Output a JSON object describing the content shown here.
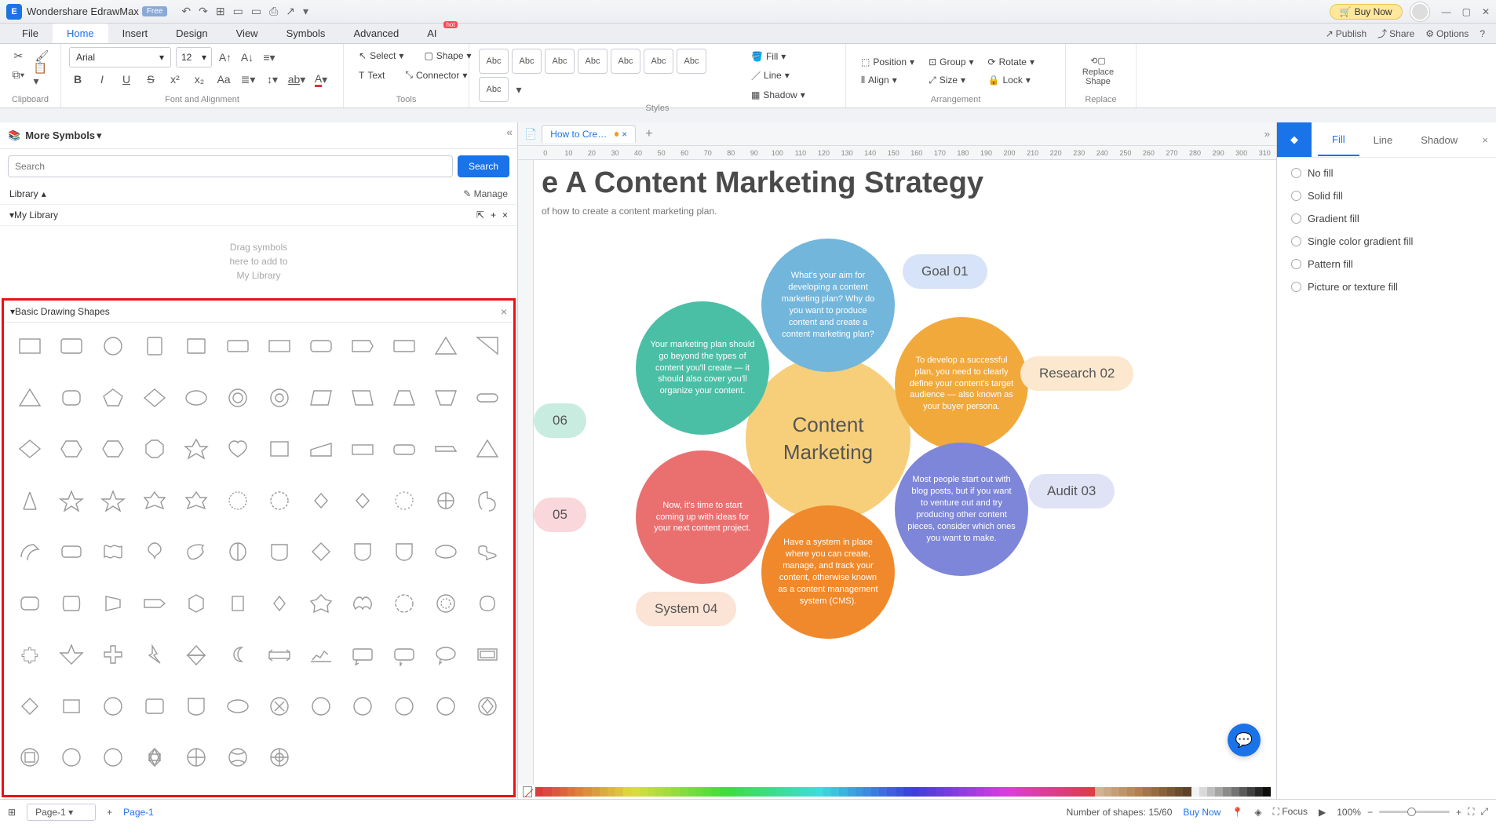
{
  "app": {
    "name": "Wondershare EdrawMax",
    "badge": "Free",
    "buy": "Buy Now"
  },
  "menu": {
    "items": [
      "File",
      "Home",
      "Insert",
      "Design",
      "View",
      "Symbols",
      "Advanced",
      "AI"
    ],
    "active": "Home",
    "right": {
      "publish": "Publish",
      "share": "Share",
      "options": "Options"
    }
  },
  "ribbon": {
    "clipboard": "Clipboard",
    "font_align": "Font and Alignment",
    "tools": "Tools",
    "styles": "Styles",
    "arrangement": "Arrangement",
    "replace": "Replace",
    "font": "Arial",
    "size": "12",
    "select": "Select",
    "shape": "Shape",
    "text": "Text",
    "connector": "Connector",
    "abc": "Abc",
    "fill": "Fill",
    "line": "Line",
    "shadow": "Shadow",
    "position": "Position",
    "align": "Align",
    "group": "Group",
    "size_btn": "Size",
    "rotate": "Rotate",
    "lock": "Lock",
    "replace_shape": "Replace\nShape"
  },
  "left": {
    "more_symbols": "More Symbols",
    "search_ph": "Search",
    "search_btn": "Search",
    "library": "Library",
    "manage": "Manage",
    "mylib": "My Library",
    "mylib_hint": "Drag symbols\nhere to add to\nMy Library",
    "basic": "Basic Drawing Shapes"
  },
  "doc": {
    "tab": "How to Create...",
    "title": "e A Content Marketing Strategy",
    "subtitle": "of how to create a content marketing plan.",
    "center": "Content\nMarketing",
    "top": "What's your aim for developing a content marketing plan? Why do you want to produce content and create a content marketing plan?",
    "teal": "Your marketing plan should go beyond the types of content you'll create — it should also cover you'll organize your content.",
    "orange_r": "To develop a successful plan, you need to clearly define your content's target audience — also known as your buyer persona.",
    "purple": "Most people start out with blog posts, but if you want to venture out and try producing other content pieces, consider which ones you want to make.",
    "red": "Now, it's time to start coming up with ideas for your next content project.",
    "orange_b": "Have a system in place where you can create, manage, and track your content, otherwise known as a content management system (CMS).",
    "goal": "Goal 01",
    "research": "Research 02",
    "audit": "Audit 03",
    "system": "System 04",
    "p05": "05",
    "p06": "06"
  },
  "right": {
    "fill": "Fill",
    "line": "Line",
    "shadow": "Shadow",
    "opts": [
      "No fill",
      "Solid fill",
      "Gradient fill",
      "Single color gradient fill",
      "Pattern fill",
      "Picture or texture fill"
    ]
  },
  "status": {
    "page": "Page-1",
    "page_link": "Page-1",
    "shapes": "Number of shapes: 15/60",
    "buy": "Buy Now",
    "focus": "Focus",
    "zoom": "100%"
  },
  "ruler": [
    "0",
    "10",
    "20",
    "30",
    "40",
    "50",
    "60",
    "70",
    "80",
    "90",
    "100",
    "110",
    "120",
    "130",
    "140",
    "150",
    "160",
    "170",
    "180",
    "190",
    "200",
    "210",
    "220",
    "230",
    "240",
    "250",
    "260",
    "270",
    "280",
    "290",
    "300",
    "310"
  ]
}
